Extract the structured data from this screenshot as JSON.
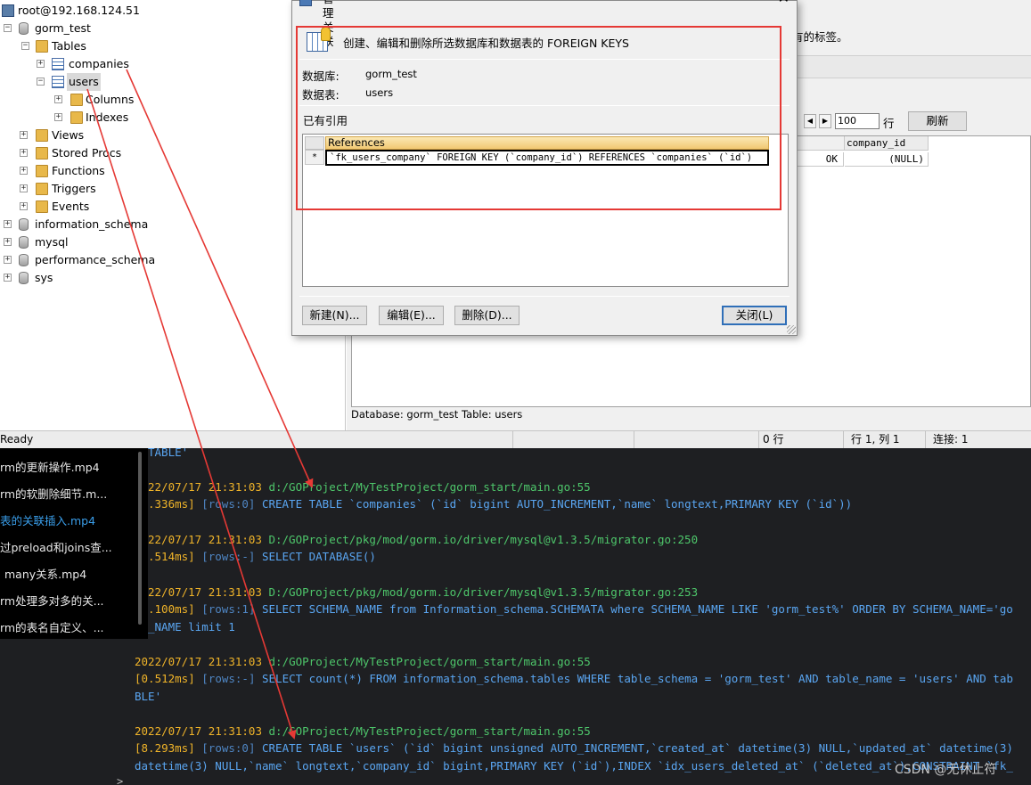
{
  "tree": {
    "connection": "root@192.168.124.51",
    "database": "gorm_test",
    "tables_folder": "Tables",
    "companies": "companies",
    "users": "users",
    "columns": "Columns",
    "indexes": "Indexes",
    "views": "Views",
    "procs": "Stored Procs",
    "functions": "Functions",
    "triggers": "Triggers",
    "events": "Events",
    "information_schema": "information_schema",
    "mysql": "mysql",
    "performance_schema": "performance_schema",
    "sys": "sys"
  },
  "right_pane": {
    "info_text": "有的标签。",
    "rows_value": "100",
    "rows_unit": "行",
    "refresh_label": "刷新",
    "grid_header": "company_id",
    "grid_status": "OK",
    "grid_value": "(NULL)",
    "footer": "Database: gorm_test  Table: users"
  },
  "statusbar": {
    "ready": "Ready",
    "rows": "0 行",
    "position": "行 1, 列 1",
    "connections": "连接: 1"
  },
  "dialog": {
    "title": "管理关联",
    "description": "创建、编辑和删除所选数据库和数据表的 FOREIGN KEYS",
    "db_label": "数据库:",
    "db_value": "gorm_test",
    "table_label": "数据表:",
    "table_value": "users",
    "refs_title": "已有引用",
    "refs_header": "References",
    "refs_marker": "*",
    "refs_row": "`fk_users_company` FOREIGN KEY (`company_id`) REFERENCES `companies` (`id`)",
    "btn_new": "新建(N)...",
    "btn_edit": "编辑(E)...",
    "btn_delete": "删除(D)...",
    "btn_close": "关闭(L)",
    "close_glyph": "✕"
  },
  "playlist": {
    "items": [
      "rm的更新操作.mp4",
      "rm的软删除细节.m...",
      "表的关联插入.mp4",
      "过preload和joins查...",
      "many关系.mp4",
      "rm处理多对多的关...",
      "rm的表名自定义、..."
    ]
  },
  "terminal": {
    "line0": "TABLE'",
    "line1_date": "22/07/17 21:31:03 ",
    "line1_path": "d:/GOProject/MyTestProject/gorm_start/main.go:55",
    "line2_time": ".336ms] ",
    "line2_rows": "[rows:0] ",
    "line2_sql": "CREATE TABLE `companies` (`id` bigint AUTO_INCREMENT,`name` longtext,PRIMARY KEY (`id`))",
    "line3_date": "22/07/17 21:31:03 ",
    "line3_path": "D:/GOProject/pkg/mod/gorm.io/driver/mysql@v1.3.5/migrator.go:250",
    "line4_time": ".514ms] ",
    "line4_rows": "[rows:-] ",
    "line4_sql": "SELECT DATABASE()",
    "line5_date": "22/07/17 21:31:03 ",
    "line5_path": "D:/GOProject/pkg/mod/gorm.io/driver/mysql@v1.3.5/migrator.go:253",
    "line6_time": ".100ms] ",
    "line6_rows": "[rows:1] ",
    "line6_sql": "SELECT SCHEMA_NAME from Information_schema.SCHEMATA where SCHEMA_NAME LIKE 'gorm_test%' ORDER BY SCHEMA_NAME='go",
    "line7": "_NAME limit 1",
    "line8_date": "2022/07/17 21:31:03 ",
    "line8_path": "d:/GOProject/MyTestProject/gorm_start/main.go:55",
    "line9_time": "[0.512ms] ",
    "line9_rows": "[rows:-] ",
    "line9_sql": "SELECT count(*) FROM information_schema.tables WHERE table_schema = 'gorm_test' AND table_name = 'users' AND tab",
    "line10": "BLE'",
    "line11_date": "2022/07/17 21:31:03 ",
    "line11_path": "d:/GOProject/MyTestProject/gorm_start/main.go:55",
    "line12_time": "[8.293ms] ",
    "line12_rows": "[rows:0] ",
    "line12_sql": "CREATE TABLE `users` (`id` bigint unsigned AUTO_INCREMENT,`created_at` datetime(3) NULL,`updated_at` datetime(3)",
    "line13": "datetime(3) NULL,`name` longtext,`company_id` bigint,PRIMARY KEY (`id`),INDEX `idx_users_deleted_at` (`deleted_at`),CONSTRAINT `fk_",
    "prompt": ">"
  },
  "watermark": "CSDN @无休止符",
  "colors": {
    "annotation": "#e53935",
    "terminal_bg": "#1e1f22",
    "sql_blue": "#5aa6f2",
    "path_green": "#4ec76b",
    "time_yellow": "#f0b429"
  }
}
